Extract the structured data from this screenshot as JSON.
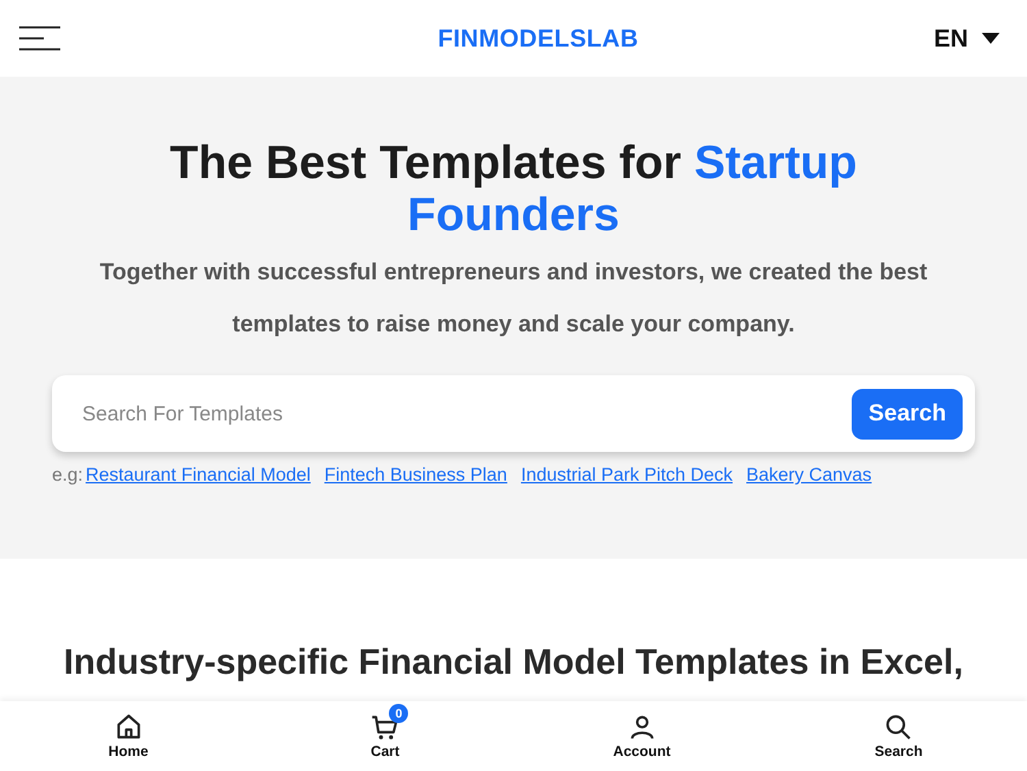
{
  "header": {
    "logo": "FINMODELSLAB",
    "language": "EN"
  },
  "hero": {
    "title": "The Best Templates for",
    "title_highlight": "Startup Founders",
    "subtitle": "Together with successful entrepreneurs and investors, we created the best templates to raise money and scale your company.",
    "search": {
      "placeholder": "Search For Templates",
      "button": "Search"
    },
    "examples_label": "e.g:",
    "examples": [
      "Restaurant Financial Model",
      "Fintech Business Plan",
      "Industrial Park Pitch Deck",
      "Bakery Canvas"
    ]
  },
  "section": {
    "heading": "Industry-specific Financial Model Templates in Excel,"
  },
  "bottom_nav": [
    {
      "kind": "home",
      "label": "Home"
    },
    {
      "kind": "cart",
      "label": "Cart",
      "badge": "0"
    },
    {
      "kind": "account",
      "label": "Account"
    },
    {
      "kind": "search",
      "label": "Search"
    }
  ]
}
